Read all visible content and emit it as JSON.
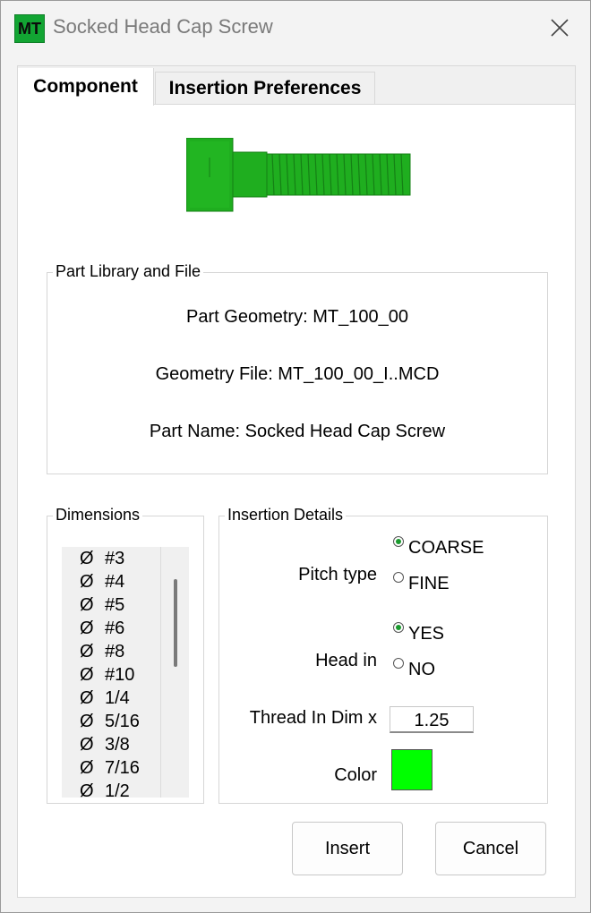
{
  "window": {
    "app_icon_text": "MT",
    "title": "Socked Head Cap Screw"
  },
  "tabs": [
    {
      "label": "Component",
      "selected": true
    },
    {
      "label": "Insertion Preferences",
      "selected": false
    }
  ],
  "part_library": {
    "group_label": "Part Library and File",
    "part_geometry": "Part Geometry: MT_100_00",
    "geometry_file": "Geometry File: MT_100_00_I..MCD",
    "part_name": "Part Name: Socked Head Cap Screw"
  },
  "dimensions": {
    "group_label": "Dimensions",
    "symbol": "Ø",
    "items": [
      "#3",
      "#4",
      "#5",
      "#6",
      "#8",
      "#10",
      "1/4",
      "5/16",
      "3/8",
      "7/16",
      "1/2"
    ]
  },
  "insertion_details": {
    "group_label": "Insertion Details",
    "pitch_type": {
      "label": "Pitch type",
      "options": [
        "COARSE",
        "FINE"
      ],
      "selected": "COARSE"
    },
    "head_in": {
      "label": "Head in",
      "options": [
        "YES",
        "NO"
      ],
      "selected": "YES"
    },
    "thread_in_dim": {
      "label": "Thread In Dim x",
      "value": "1.25"
    },
    "color": {
      "label": "Color",
      "value": "#00ff00"
    }
  },
  "buttons": {
    "insert": "Insert",
    "cancel": "Cancel"
  },
  "colors": {
    "part_green": "#1fae1f",
    "accent_green": "#1a9a2e"
  }
}
